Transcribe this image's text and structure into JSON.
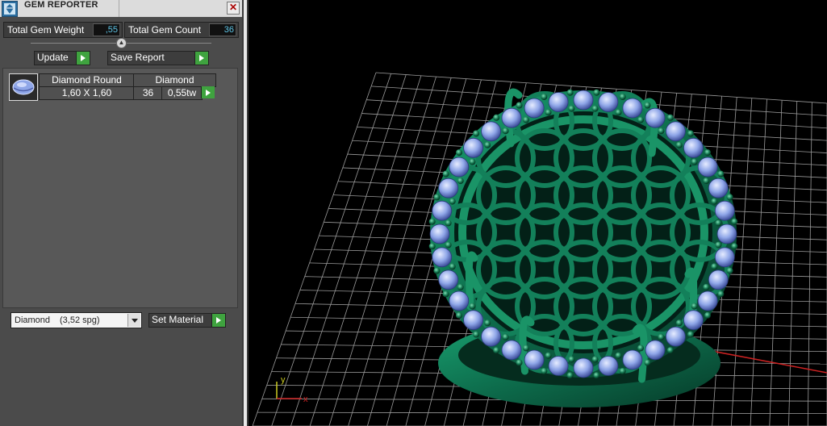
{
  "window": {
    "title": "GEM REPORTER",
    "close_glyph": "✕"
  },
  "stats": {
    "weight_label": "Total Gem Weight",
    "weight_value": ",55",
    "count_label": "Total Gem Count",
    "count_value": "36"
  },
  "actions": {
    "update_label": "Update",
    "save_label": "Save Report"
  },
  "gem_table": {
    "headers": [
      "Diamond Round",
      "Diamond"
    ],
    "rows": [
      {
        "size": "1,60 X 1,60",
        "count": "36",
        "weight": "0,55tw"
      }
    ]
  },
  "material": {
    "selected_name": "Diamond",
    "selected_spg": "(3,52 spg)",
    "set_label": "Set Material"
  },
  "viewport": {
    "axis_y": "y",
    "axis_x": "x",
    "colors": {
      "ring": "#0f6b4d",
      "gem": "#7f9be6",
      "grid": "#bfbfbf",
      "axis_x": "#cc2222",
      "axis_y": "#cccc22"
    }
  },
  "icons": [
    "gem-reporter-icon",
    "close-icon",
    "slider-knob-icon",
    "play-icon",
    "gem-thumbnail-icon",
    "dropdown-arrow-icon"
  ]
}
